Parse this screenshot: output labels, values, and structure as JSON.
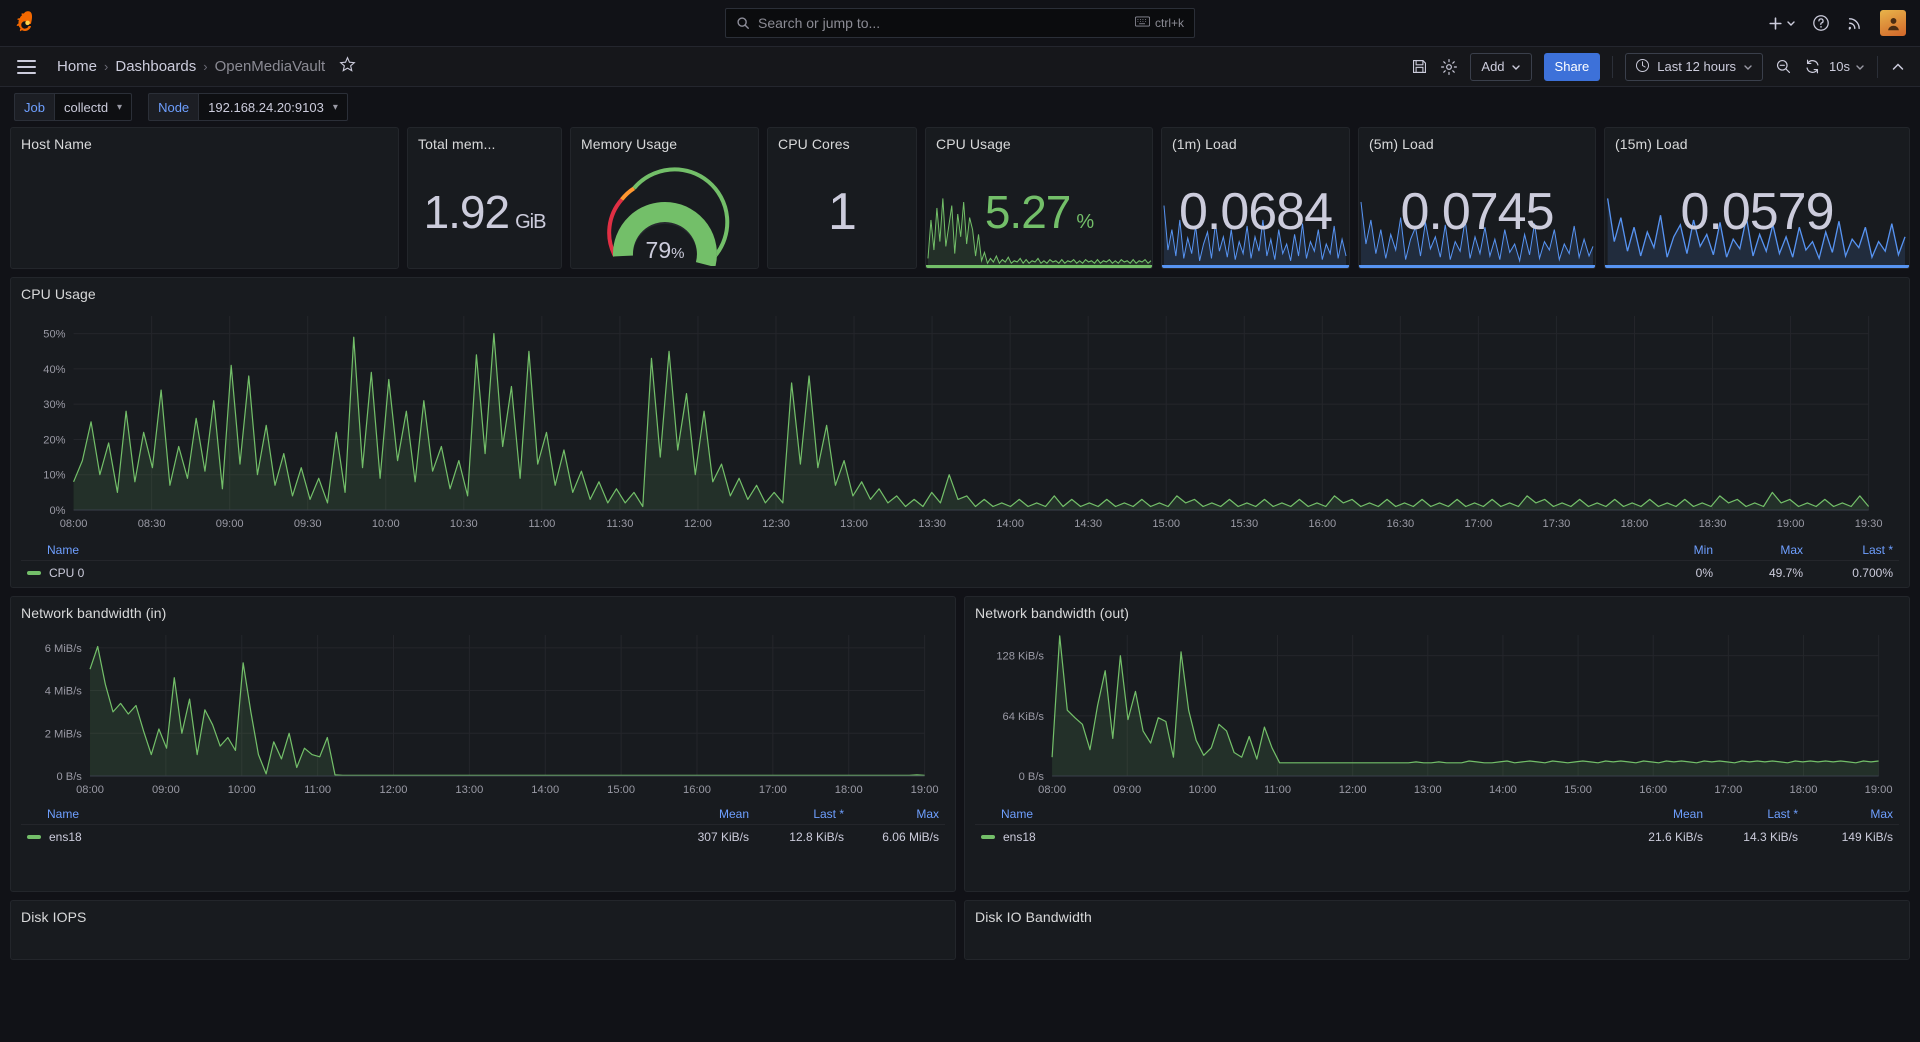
{
  "topnav": {
    "logo_icon": "grafana-logo-icon",
    "search": {
      "placeholder": "Search or jump to...",
      "icon": "search-icon",
      "shortcut": "ctrl+k",
      "shortcut_icon": "keyboard-icon"
    },
    "actions": [
      {
        "name": "new-button",
        "icon": "plus-icon",
        "label": "+"
      },
      {
        "name": "help-button",
        "icon": "help-circle-icon"
      },
      {
        "name": "news-button",
        "icon": "rss-icon"
      },
      {
        "name": "user-avatar",
        "icon": "avatar-icon"
      }
    ]
  },
  "breadcrumb": {
    "menu_icon": "hamburger-menu-icon",
    "items": [
      {
        "label": "Home",
        "current": false
      },
      {
        "label": "Dashboards",
        "current": false
      },
      {
        "label": "OpenMediaVault",
        "current": true
      }
    ],
    "separator": "›",
    "star_icon": "star-outline-icon"
  },
  "toolbar": {
    "save_icon": "save-disk-icon",
    "settings_icon": "gear-icon",
    "add_label": "Add",
    "share_label": "Share",
    "time_range": "Last 12 hours",
    "time_icon": "clock-icon",
    "zoom_out_icon": "zoom-out-icon",
    "refresh_icon": "refresh-icon",
    "refresh_interval": "10s",
    "collapse_icon": "chevron-up-icon"
  },
  "variables": [
    {
      "name": "job",
      "label": "Job",
      "value": "collectd"
    },
    {
      "name": "node",
      "label": "Node",
      "value": "192.168.24.20:9103"
    }
  ],
  "stats": [
    {
      "name": "host-name",
      "title": "Host Name",
      "value": "",
      "unit": "",
      "kind": "empty"
    },
    {
      "name": "total-memory",
      "title": "Total mem...",
      "value": "1.92",
      "unit": "GiB",
      "kind": "text"
    },
    {
      "name": "memory-usage",
      "title": "Memory Usage",
      "value": "79",
      "unit": "%",
      "kind": "gauge",
      "gauge_percent": 79
    },
    {
      "name": "cpu-cores",
      "title": "CPU Cores",
      "value": "1",
      "unit": "",
      "kind": "text"
    },
    {
      "name": "cpu-usage",
      "title": "CPU Usage",
      "value": "5.27",
      "unit": "%",
      "kind": "sparkline",
      "color": "#73bf69"
    },
    {
      "name": "load-1m",
      "title": "(1m) Load",
      "value": "0.0684",
      "unit": "",
      "kind": "sparkline",
      "color": "#5794f2"
    },
    {
      "name": "load-5m",
      "title": "(5m) Load",
      "value": "0.0745",
      "unit": "",
      "kind": "sparkline",
      "color": "#5794f2"
    },
    {
      "name": "load-15m",
      "title": "(15m) Load",
      "value": "0.0579",
      "unit": "",
      "kind": "sparkline",
      "color": "#5794f2"
    }
  ],
  "panels": {
    "cpu_usage": {
      "title": "CPU Usage",
      "legend_headers": [
        "Name",
        "Min",
        "Max",
        "Last *"
      ],
      "rows": [
        {
          "name": "CPU 0",
          "color": "#73bf69",
          "min": "0%",
          "max": "49.7%",
          "last": "0.700%"
        }
      ]
    },
    "net_in": {
      "title": "Network bandwidth (in)",
      "legend_headers": [
        "Name",
        "Mean",
        "Last *",
        "Max"
      ],
      "rows": [
        {
          "name": "ens18",
          "color": "#73bf69",
          "mean": "307 KiB/s",
          "last": "12.8 KiB/s",
          "max": "6.06 MiB/s"
        }
      ]
    },
    "net_out": {
      "title": "Network bandwidth (out)",
      "legend_headers": [
        "Name",
        "Mean",
        "Last *",
        "Max"
      ],
      "rows": [
        {
          "name": "ens18",
          "color": "#73bf69",
          "mean": "21.6 KiB/s",
          "last": "14.3 KiB/s",
          "max": "149 KiB/s"
        }
      ]
    },
    "disk_iops": {
      "title": "Disk IOPS"
    },
    "disk_io_bw": {
      "title": "Disk IO Bandwidth"
    }
  },
  "chart_data": [
    {
      "name": "cpu_usage_timeseries",
      "type": "area",
      "title": "CPU Usage",
      "xlabel": "",
      "ylabel": "",
      "ylim": [
        0,
        55
      ],
      "yticks": [
        "0%",
        "10%",
        "20%",
        "30%",
        "40%",
        "50%"
      ],
      "ytick_values": [
        0,
        10,
        20,
        30,
        40,
        50
      ],
      "xticks": [
        "08:00",
        "08:30",
        "09:00",
        "09:30",
        "10:00",
        "10:30",
        "11:00",
        "11:30",
        "12:00",
        "12:30",
        "13:00",
        "13:30",
        "14:00",
        "14:30",
        "15:00",
        "15:30",
        "16:00",
        "16:30",
        "17:00",
        "17:30",
        "18:00",
        "18:30",
        "19:00",
        "19:30"
      ],
      "grid": true,
      "legend_position": "bottom",
      "series": [
        {
          "name": "CPU 0",
          "color": "#73bf69",
          "stats": {
            "min": "0%",
            "max": "49.7%",
            "last": "0.700%"
          },
          "values": [
            8,
            14,
            25,
            10,
            19,
            5,
            28,
            8,
            22,
            12,
            34,
            7,
            18,
            9,
            26,
            11,
            31,
            6,
            41,
            13,
            38,
            10,
            24,
            7,
            16,
            4,
            12,
            3,
            9,
            2,
            22,
            5,
            49,
            12,
            39,
            9,
            37,
            14,
            28,
            8,
            31,
            11,
            18,
            6,
            14,
            4,
            44,
            16,
            50,
            18,
            35,
            9,
            45,
            13,
            22,
            7,
            17,
            5,
            11,
            3,
            8,
            2,
            6,
            2,
            5,
            1,
            43,
            15,
            45,
            17,
            33,
            10,
            28,
            8,
            13,
            4,
            9,
            3,
            7,
            2,
            5,
            2,
            36,
            13,
            38,
            12,
            24,
            7,
            14,
            4,
            8,
            3,
            6,
            2,
            4,
            1,
            3,
            1,
            5,
            2,
            10,
            3,
            4,
            1,
            3,
            1,
            2,
            1,
            3,
            1,
            2,
            1,
            4,
            1,
            3,
            1,
            2,
            1,
            3,
            1,
            2,
            1,
            3,
            1,
            2,
            1,
            4,
            2,
            3,
            1,
            2,
            1,
            3,
            1,
            2,
            1,
            3,
            1,
            2,
            1,
            3,
            1,
            2,
            1,
            4,
            2,
            3,
            1,
            2,
            1,
            3,
            1,
            2,
            1,
            3,
            1,
            2,
            1,
            3,
            1,
            2,
            1,
            3,
            1,
            2,
            1,
            4,
            2,
            3,
            1,
            2,
            1,
            3,
            1,
            2,
            1,
            3,
            1,
            2,
            1,
            3,
            1,
            2,
            1,
            3,
            1,
            2,
            1,
            4,
            2,
            3,
            1,
            2,
            1,
            5,
            2,
            3,
            1,
            2,
            1,
            3,
            1,
            2,
            1,
            4,
            1
          ]
        }
      ]
    },
    {
      "name": "network_bandwidth_in",
      "type": "area",
      "title": "Network bandwidth (in)",
      "xlabel": "",
      "ylabel": "",
      "ylim": [
        0,
        6.6
      ],
      "yticks": [
        "0 B/s",
        "2 MiB/s",
        "4 MiB/s",
        "6 MiB/s"
      ],
      "ytick_values": [
        0,
        2,
        4,
        6
      ],
      "xticks": [
        "08:00",
        "09:00",
        "10:00",
        "11:00",
        "12:00",
        "13:00",
        "14:00",
        "15:00",
        "16:00",
        "17:00",
        "18:00",
        "19:00"
      ],
      "grid": true,
      "legend_position": "bottom",
      "series": [
        {
          "name": "ens18",
          "color": "#73bf69",
          "stats": {
            "mean": "307 KiB/s",
            "last": "12.8 KiB/s",
            "max": "6.06 MiB/s"
          },
          "values": [
            5.0,
            6.06,
            4.3,
            3.0,
            3.4,
            2.9,
            3.3,
            2.1,
            1.0,
            2.2,
            1.3,
            4.6,
            2.0,
            3.6,
            1.0,
            3.1,
            2.4,
            1.4,
            1.8,
            1.2,
            5.3,
            3.0,
            1.0,
            0.1,
            1.6,
            0.8,
            2.0,
            0.4,
            1.3,
            1.0,
            0.9,
            1.8,
            0.05,
            0.03,
            0.03,
            0.03,
            0.03,
            0.03,
            0.03,
            0.03,
            0.03,
            0.03,
            0.03,
            0.03,
            0.03,
            0.03,
            0.03,
            0.03,
            0.03,
            0.03,
            0.03,
            0.03,
            0.03,
            0.03,
            0.03,
            0.03,
            0.03,
            0.03,
            0.03,
            0.03,
            0.03,
            0.03,
            0.03,
            0.03,
            0.03,
            0.03,
            0.03,
            0.03,
            0.03,
            0.03,
            0.03,
            0.03,
            0.03,
            0.03,
            0.03,
            0.03,
            0.03,
            0.03,
            0.03,
            0.03,
            0.03,
            0.03,
            0.03,
            0.03,
            0.03,
            0.03,
            0.03,
            0.03,
            0.03,
            0.03,
            0.03,
            0.03,
            0.03,
            0.03,
            0.03,
            0.03,
            0.03,
            0.03,
            0.03,
            0.03,
            0.03,
            0.03,
            0.03,
            0.03,
            0.03,
            0.03,
            0.03,
            0.03,
            0.05,
            0.03
          ]
        }
      ]
    },
    {
      "name": "network_bandwidth_out",
      "type": "area",
      "title": "Network bandwidth (out)",
      "xlabel": "",
      "ylabel": "",
      "ylim": [
        0,
        150
      ],
      "yticks": [
        "0 B/s",
        "64 KiB/s",
        "128 KiB/s"
      ],
      "ytick_values": [
        0,
        64,
        128
      ],
      "xticks": [
        "08:00",
        "09:00",
        "10:00",
        "11:00",
        "12:00",
        "13:00",
        "14:00",
        "15:00",
        "16:00",
        "17:00",
        "18:00",
        "19:00"
      ],
      "grid": true,
      "legend_position": "bottom",
      "series": [
        {
          "name": "ens18",
          "color": "#73bf69",
          "stats": {
            "mean": "21.6 KiB/s",
            "last": "14.3 KiB/s",
            "max": "149 KiB/s"
          },
          "values": [
            20,
            149,
            70,
            62,
            55,
            28,
            75,
            112,
            40,
            128,
            60,
            90,
            48,
            35,
            62,
            58,
            20,
            132,
            70,
            38,
            22,
            30,
            55,
            48,
            25,
            20,
            42,
            18,
            52,
            30,
            14,
            14,
            14,
            14,
            14,
            14,
            14,
            14,
            14,
            14,
            14,
            14,
            14,
            14,
            14,
            14,
            14,
            14,
            15,
            14,
            14,
            15,
            14,
            14,
            14,
            16,
            15,
            14,
            14,
            15,
            16,
            14,
            15,
            16,
            15,
            14,
            16,
            15,
            14,
            15,
            16,
            15,
            14,
            16,
            15,
            16,
            15,
            14,
            16,
            15,
            14,
            16,
            15,
            16,
            15,
            14,
            16,
            15,
            16,
            15,
            14,
            16,
            15,
            16,
            15,
            16,
            15,
            14,
            16,
            15,
            16,
            15,
            16,
            15,
            16,
            15,
            14,
            16,
            15,
            16
          ]
        }
      ]
    }
  ]
}
